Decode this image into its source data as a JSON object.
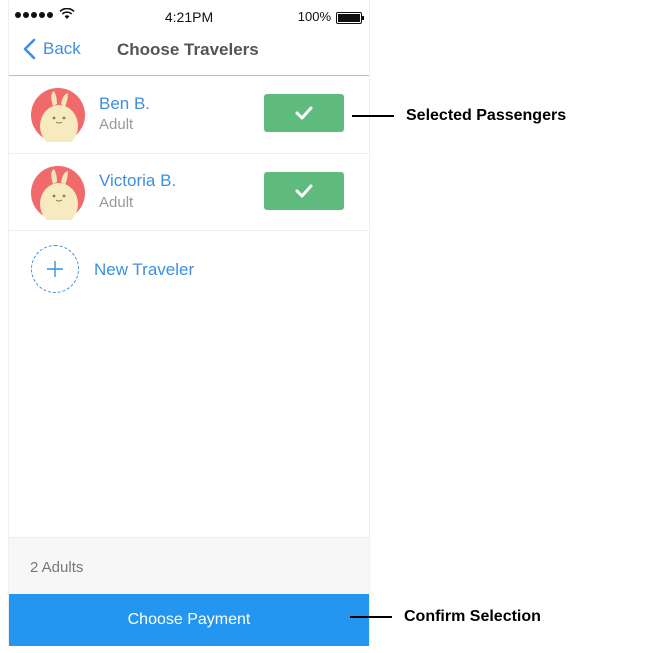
{
  "status_bar": {
    "time": "4:21PM",
    "battery": "100%",
    "signal_dots": 5
  },
  "nav": {
    "back_label": "Back",
    "title": "Choose Travelers"
  },
  "travelers": [
    {
      "name": "Ben B.",
      "type": "Adult",
      "selected": true
    },
    {
      "name": "Victoria B.",
      "type": "Adult",
      "selected": true
    }
  ],
  "new_traveler_label": "New Traveler",
  "summary": "2 Adults",
  "cta_label": "Choose Payment",
  "annotations": {
    "selected": "Selected Passengers",
    "confirm": "Confirm Selection"
  },
  "colors": {
    "accent_blue": "#3d8fe0",
    "check_green": "#5fba7d",
    "cta_blue": "#2496ef"
  }
}
